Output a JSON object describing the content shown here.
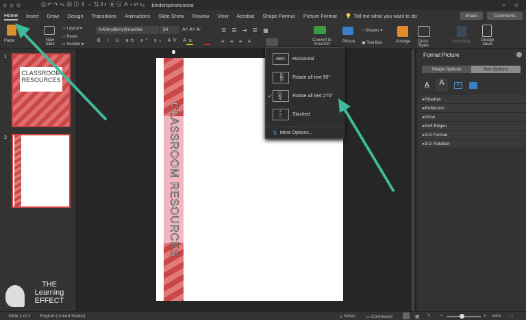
{
  "title_bar": {
    "document_name": "binderspinetutorial"
  },
  "tabs": [
    {
      "label": "Home",
      "active": true
    },
    {
      "label": "Insert"
    },
    {
      "label": "Draw"
    },
    {
      "label": "Design"
    },
    {
      "label": "Transitions"
    },
    {
      "label": "Animations"
    },
    {
      "label": "Slide Show"
    },
    {
      "label": "Review"
    },
    {
      "label": "View"
    },
    {
      "label": "Acrobat"
    },
    {
      "label": "Shape Format"
    },
    {
      "label": "Picture Format"
    }
  ],
  "tell_me": "Tell me what you want to do",
  "share_label": "Share",
  "comments_label": "Comments",
  "ribbon": {
    "paste": "Paste",
    "new_slide": "New\nSlide",
    "layout": "Layout",
    "reset": "Reset",
    "section": "Section",
    "font_name": "KAVeryBerrySmoothie",
    "font_size": "54",
    "convert_smartart": "Convert to SmartArt",
    "picture": "Picture",
    "shapes": "Shapes",
    "text_box": "Text Box",
    "arrange": "Arrange",
    "quick_styles": "Quick Styles",
    "sensitivity": "Sensitivity",
    "design_ideas": "Design Ideas"
  },
  "thumbnails": [
    {
      "number": "1",
      "text": "CLASSROOM RESOURCES"
    },
    {
      "number": "2",
      "selected": true
    }
  ],
  "slide": {
    "spine_text": "CLASSROOM RESOURCES"
  },
  "text_direction_menu": {
    "items": [
      {
        "label": "Horizontal",
        "icon": "ABC"
      },
      {
        "label": "Rotate all text 90°",
        "icon": "ABC"
      },
      {
        "label": "Rotate all text 270°",
        "icon": "ABC",
        "checked": true
      },
      {
        "label": "Stacked",
        "icon": "A B C"
      }
    ],
    "more_options": "More Options..."
  },
  "format_pane": {
    "title": "Format Picture",
    "tabs": [
      "Shape Options",
      "Text Options"
    ],
    "active_tab": "Text Options",
    "sections": [
      "Shadow",
      "Reflection",
      "Glow",
      "Soft Edges",
      "3-D Format",
      "3-D Rotation"
    ]
  },
  "watermark": {
    "text": "THE Learning EFFECT"
  },
  "status_bar": {
    "slide": "Slide 2 of 2",
    "language": "English (United States)",
    "notes": "Notes",
    "comments": "Comments",
    "zoom": "84%"
  },
  "colors": {
    "accent_arrow": "#3dbb9c",
    "spine_red": "#c94747",
    "spine_pink": "#f0b6c2"
  }
}
